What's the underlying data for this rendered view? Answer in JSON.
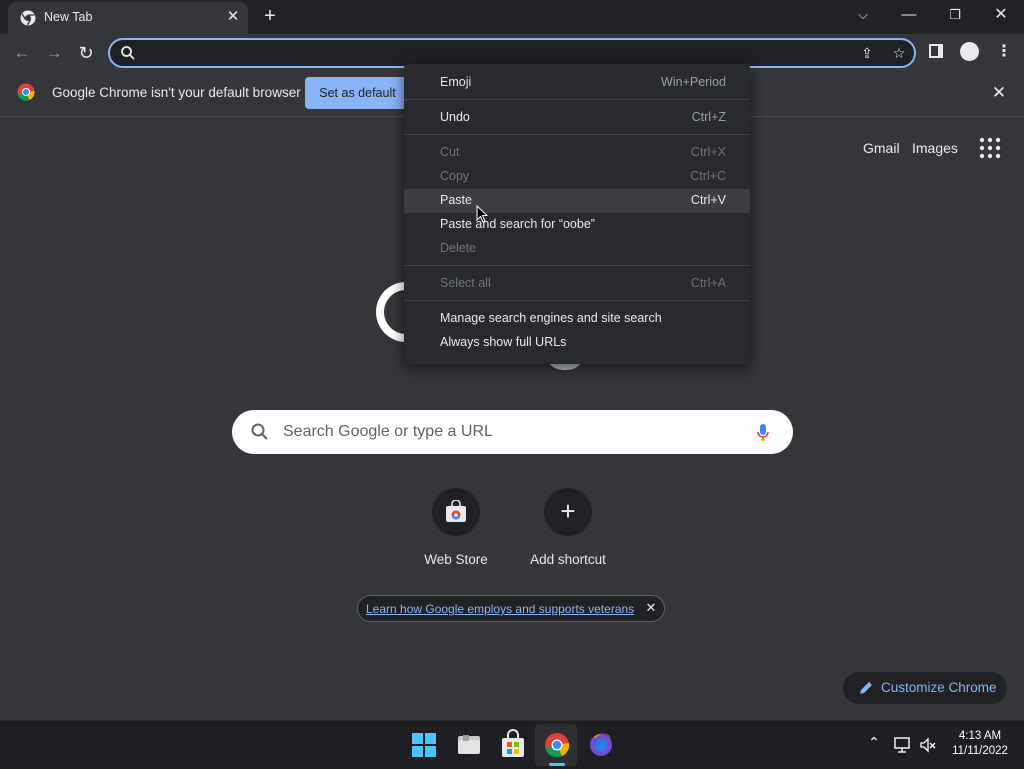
{
  "tab": {
    "title": "New Tab"
  },
  "infobar": {
    "message": "Google Chrome isn't your default browser",
    "button": "Set as default"
  },
  "ntp": {
    "gmail": "Gmail",
    "images": "Images",
    "search_placeholder": "Search Google or type a URL",
    "shortcuts": [
      {
        "label": "Web Store"
      },
      {
        "label": "Add shortcut"
      }
    ],
    "promo": "Learn how Google employs and supports veterans",
    "customize": "Customize Chrome"
  },
  "context_menu": {
    "items": [
      {
        "label": "Emoji",
        "shortcut": "Win+Period",
        "enabled": true
      },
      {
        "label": "Undo",
        "shortcut": "Ctrl+Z",
        "enabled": true
      },
      {
        "label": "Cut",
        "shortcut": "Ctrl+X",
        "enabled": false
      },
      {
        "label": "Copy",
        "shortcut": "Ctrl+C",
        "enabled": false
      },
      {
        "label": "Paste",
        "shortcut": "Ctrl+V",
        "enabled": true,
        "highlighted": true
      },
      {
        "label": "Paste and search for “oobe”",
        "shortcut": "",
        "enabled": true
      },
      {
        "label": "Delete",
        "shortcut": "",
        "enabled": false
      },
      {
        "label": "Select all",
        "shortcut": "Ctrl+A",
        "enabled": false
      },
      {
        "label": "Manage search engines and site search",
        "shortcut": "",
        "enabled": true
      },
      {
        "label": "Always show full URLs",
        "shortcut": "",
        "enabled": true
      }
    ]
  },
  "taskbar": {
    "time": "4:13 AM",
    "date": "11/11/2022"
  },
  "icons": [
    "chrome-icon",
    "search-icon",
    "mic-icon",
    "apps-grid-icon",
    "pencil-icon",
    "web-store-icon",
    "plus-icon"
  ],
  "colors": {
    "accent": "#8ab4f8",
    "background": "#35363a",
    "frame": "#202124"
  }
}
